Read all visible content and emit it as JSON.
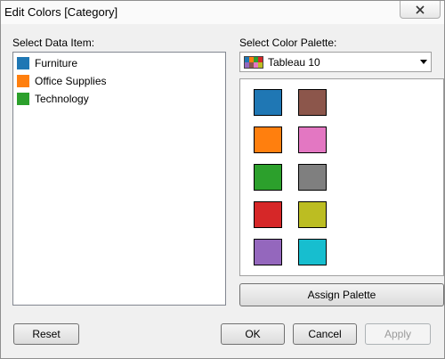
{
  "window": {
    "title": "Edit Colors [Category]",
    "close_icon": "close-icon"
  },
  "data_item": {
    "label": "Select Data Item:",
    "items": [
      {
        "label": "Furniture",
        "color": "#1f77b4"
      },
      {
        "label": "Office Supplies",
        "color": "#ff7f0e"
      },
      {
        "label": "Technology",
        "color": "#2ca02c"
      }
    ]
  },
  "palette": {
    "label": "Select Color Palette:",
    "selected": "Tableau 10",
    "colors": [
      "#1f77b4",
      "#8c564b",
      "#ff7f0e",
      "#e377c2",
      "#2ca02c",
      "#7f7f7f",
      "#d62728",
      "#bcbd22",
      "#9467bd",
      "#17becf"
    ]
  },
  "buttons": {
    "assign_palette": "Assign Palette",
    "reset": "Reset",
    "ok": "OK",
    "cancel": "Cancel",
    "apply": "Apply"
  }
}
